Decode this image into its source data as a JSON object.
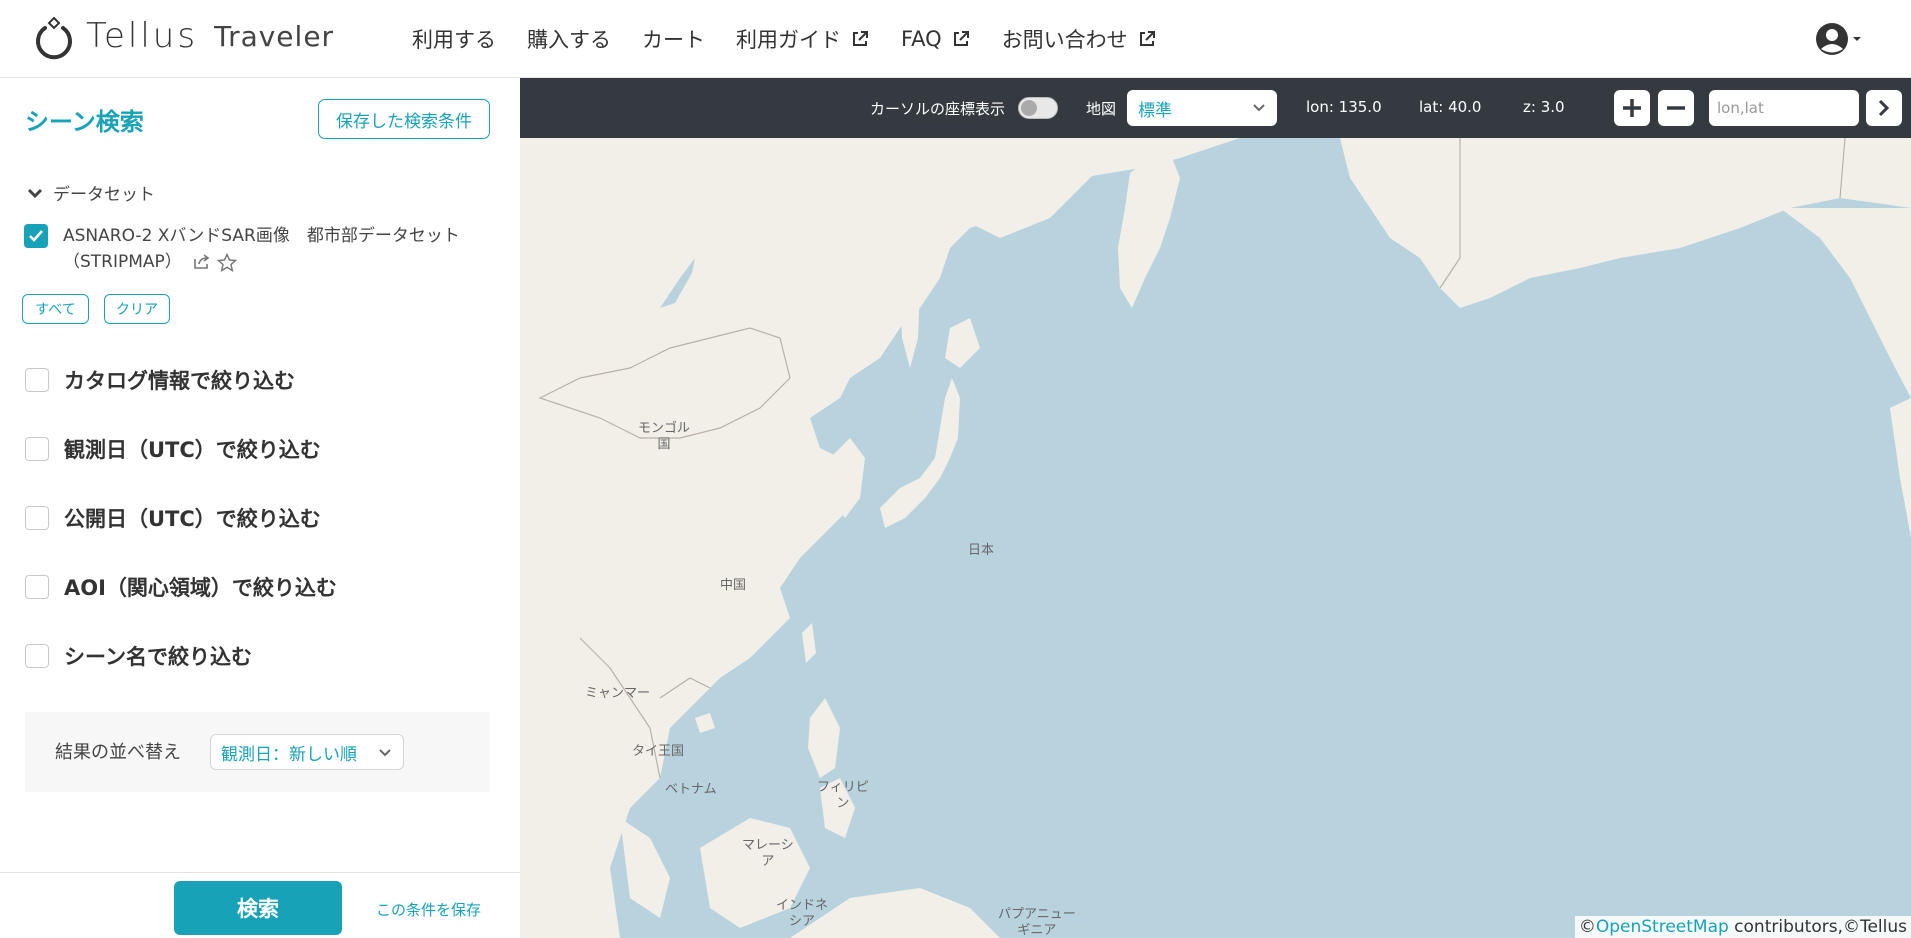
{
  "header": {
    "logo_word": "Tellus",
    "logo_sub": "Traveler",
    "nav": [
      {
        "label": "利用する",
        "external": false
      },
      {
        "label": "購入する",
        "external": false
      },
      {
        "label": "カート",
        "external": false
      },
      {
        "label": "利用ガイド",
        "external": true
      },
      {
        "label": "FAQ",
        "external": true
      },
      {
        "label": "お問い合わせ",
        "external": true
      }
    ]
  },
  "sidebar": {
    "title": "シーン検索",
    "saved_conditions_button": "保存した検索条件",
    "dataset_toggle": "データセット",
    "dataset": {
      "checked": true,
      "label_line1": "ASNARO-2 XバンドSAR画像　都市部データセット",
      "label_line2": "（STRIPMAP）"
    },
    "select_all": "すべて",
    "clear": "クリア",
    "filters": [
      {
        "label": "カタログ情報で絞り込む",
        "checked": false
      },
      {
        "label": "観測日（UTC）で絞り込む",
        "checked": false
      },
      {
        "label": "公開日（UTC）で絞り込む",
        "checked": false
      },
      {
        "label": "AOI（関心領域）で絞り込む",
        "checked": false
      },
      {
        "label": "シーン名で絞り込む",
        "checked": false
      }
    ],
    "sort": {
      "label": "結果の並べ替え",
      "selected": "観測日：新しい順"
    },
    "search_button": "検索",
    "save_condition_link": "この条件を保存"
  },
  "map": {
    "cursor_coords_label": "カーソルの座標表示",
    "cursor_coords_on": false,
    "map_type_label": "地図",
    "map_type_selected": "標準",
    "lon": "lon: 135.0",
    "lat": "lat: 40.0",
    "zoom": "z: 3.0",
    "coord_placeholder": "lon,lat",
    "attribution_prefix": "©",
    "attribution_link": "OpenStreetMap",
    "attribution_suffix": " contributors,©Tellus",
    "labels": {
      "mongolia_1": "モンゴル",
      "mongolia_2": "国",
      "japan": "日本",
      "china": "中国",
      "myanmar": "ミャンマー",
      "thailand": "タイ王国",
      "vietnam": "ベトナム",
      "philippines_1": "フィリピ",
      "philippines_2": "ン",
      "malaysia_1": "マレーシ",
      "malaysia_2": "ア",
      "indonesia_1": "インドネ",
      "indonesia_2": "シア",
      "png_1": "パプアニュー",
      "png_2": "ギニア"
    },
    "colors": {
      "water": "#b9d3de",
      "land": "#f2efe9",
      "toolbar": "#343a40",
      "accent": "#17a2b8"
    }
  }
}
